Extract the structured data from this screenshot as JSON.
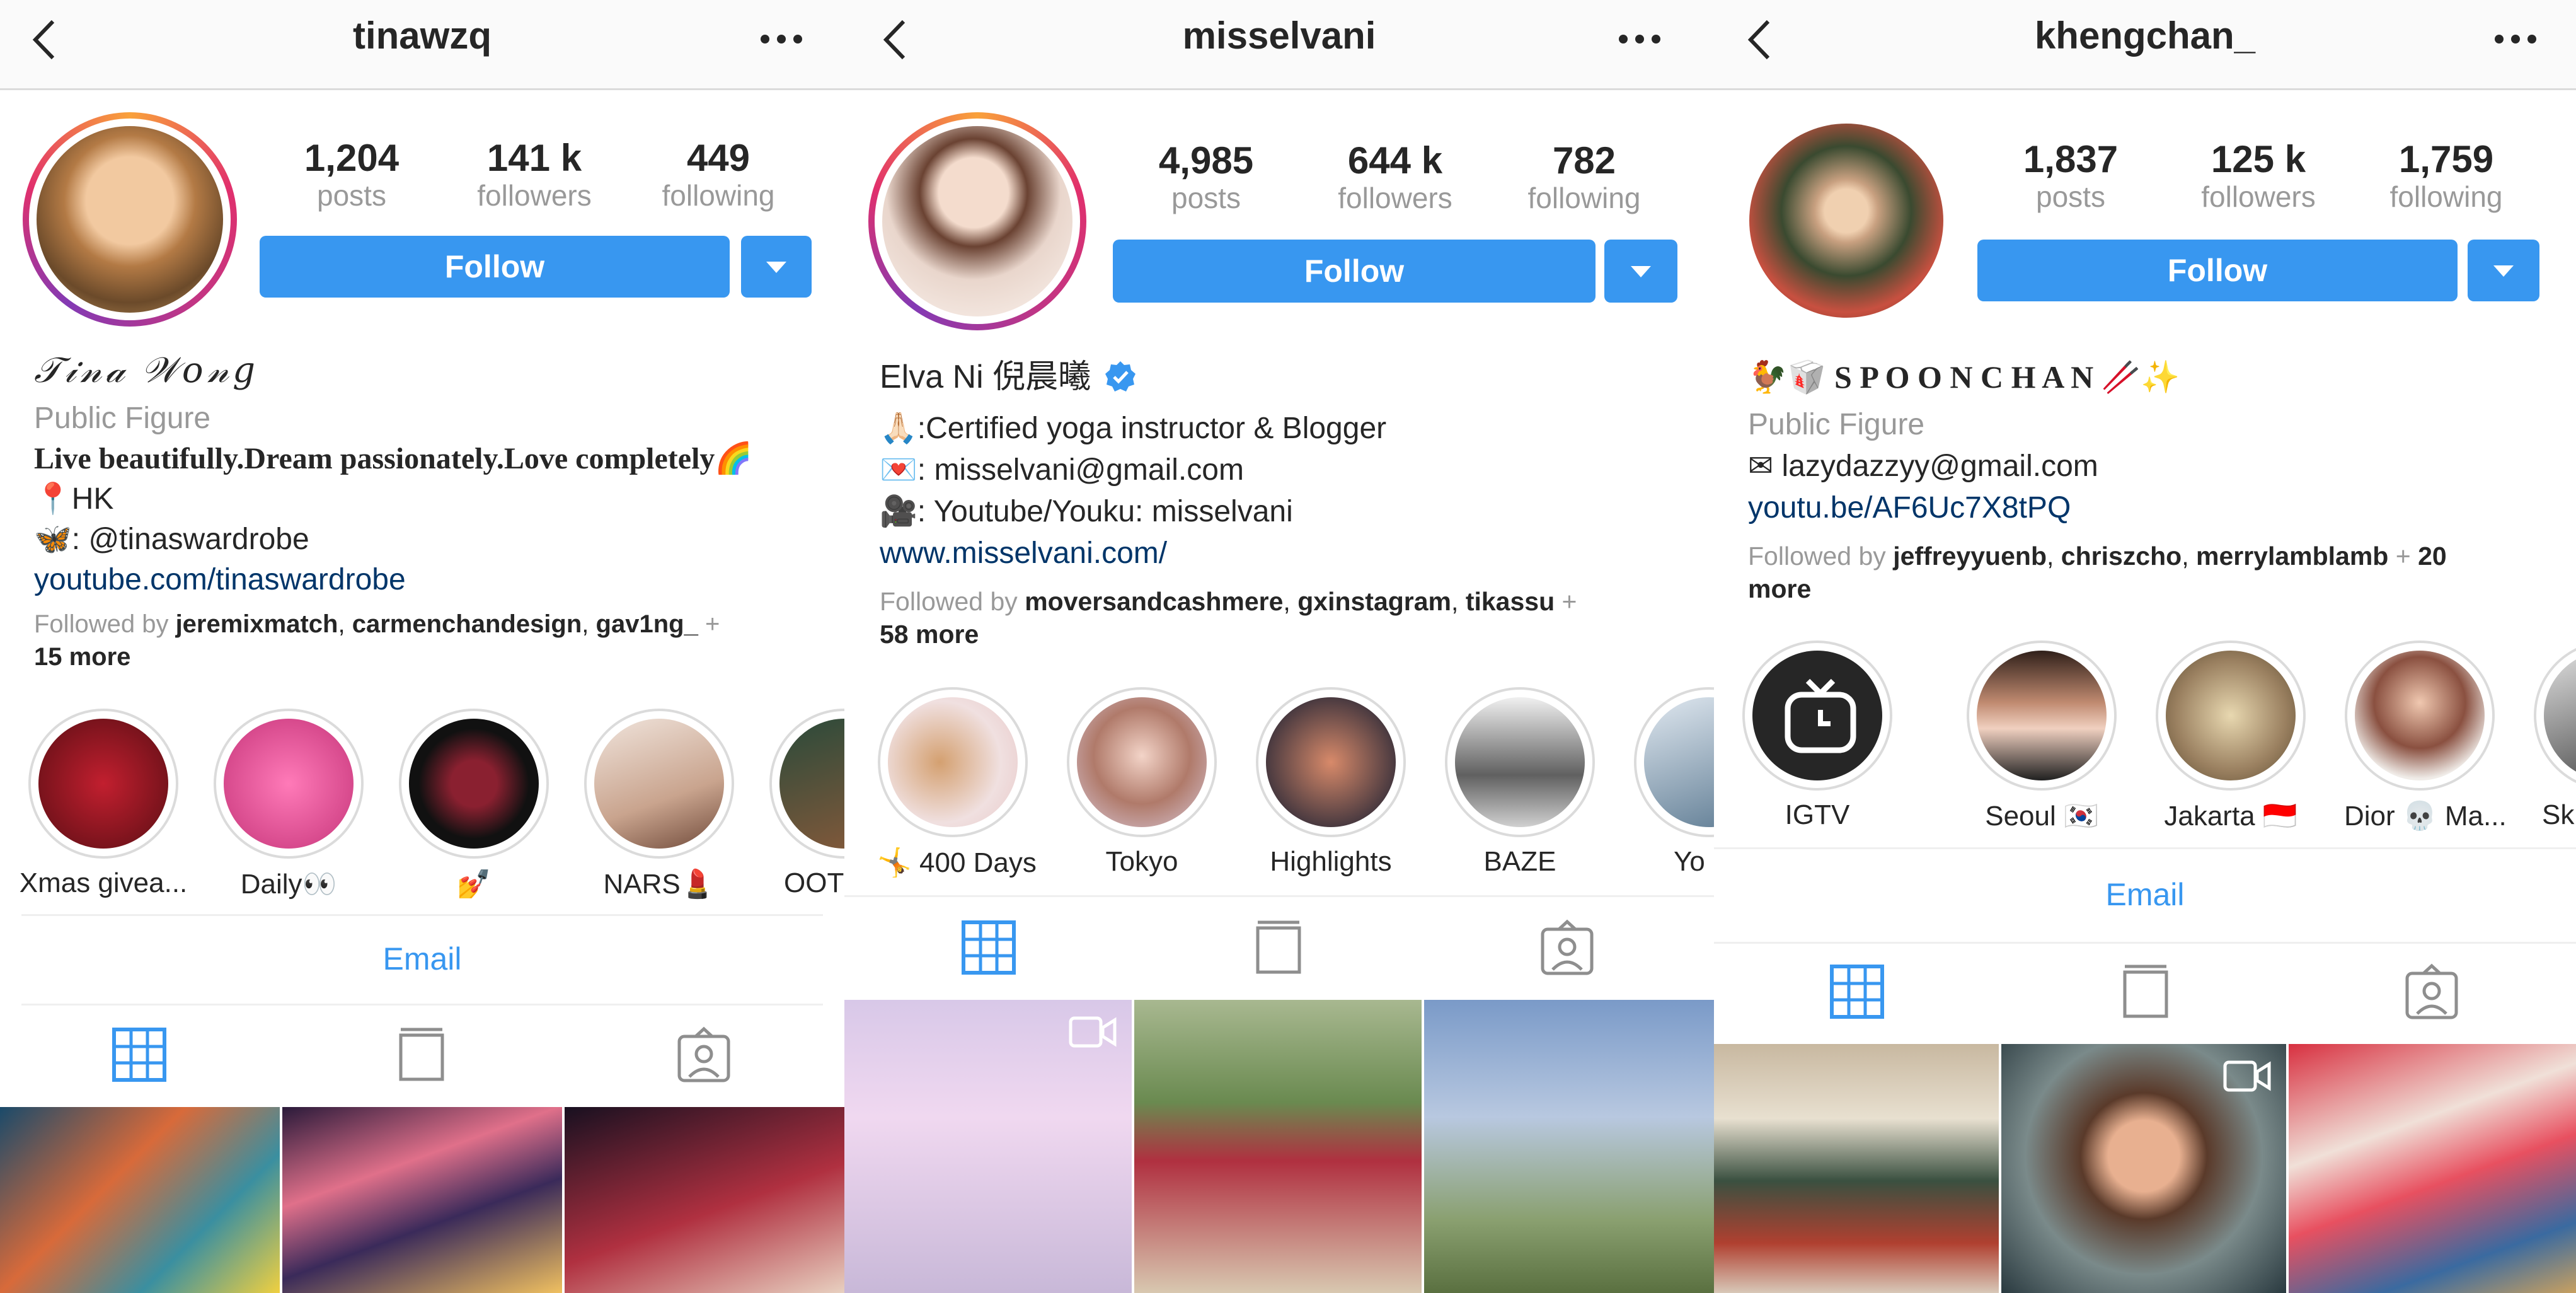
{
  "colors": {
    "accent": "#3897f0",
    "link": "#003569",
    "muted": "#999999",
    "divider": "#dbdbdb"
  },
  "profiles": [
    {
      "username": "tinawzq",
      "stats": [
        {
          "num": "1,204",
          "label": "posts"
        },
        {
          "num": "141 k",
          "label": "followers"
        },
        {
          "num": "449",
          "label": "following"
        }
      ],
      "follow_label": "Follow",
      "display_name": "𝒯𝒾𝓃𝒶 𝒲𝑜𝓃𝑔",
      "category": "Public Figure",
      "bio": [
        "Live beautifully.Dream passionately.Love completely🌈",
        "📍HK",
        "🦋: @tinaswardrobe"
      ],
      "website": "youtube.com/tinaswardrobe",
      "followed_by_prefix": "Followed by",
      "followed_by_names": [
        "jeremixmatch",
        "carmenchandesign",
        "gav1ng_"
      ],
      "followed_by_more": "15 more",
      "highlights": [
        "Xmas givea...",
        "Daily👀",
        "💅",
        "NARS💄",
        "OOT"
      ],
      "email_label": "Email",
      "tabs": [
        "grid-icon",
        "igtv-icon",
        "tagged-icon"
      ]
    },
    {
      "username": "misselvani",
      "stats": [
        {
          "num": "4,985",
          "label": "posts"
        },
        {
          "num": "644 k",
          "label": "followers"
        },
        {
          "num": "782",
          "label": "following"
        }
      ],
      "follow_label": "Follow",
      "display_name": "Elva Ni 倪晨曦",
      "verified": true,
      "bio": [
        "🙏🏻:Certified yoga instructor & Blogger",
        "💌: misselvani@gmail.com",
        "🎥: Youtube/Youku: misselvani"
      ],
      "website": "www.misselvani.com/",
      "followed_by_prefix": "Followed by",
      "followed_by_names": [
        "moversandcashmere",
        "gxinstagram",
        "tikassu"
      ],
      "followed_by_more": "58 more",
      "highlights": [
        "🤸 400 Days",
        "Tokyo",
        "Highlights",
        "BAZE",
        "Yo"
      ],
      "tabs": [
        "grid-icon",
        "igtv-icon",
        "tagged-icon"
      ]
    },
    {
      "username": "khengchan_",
      "stats": [
        {
          "num": "1,837",
          "label": "posts"
        },
        {
          "num": "125 k",
          "label": "followers"
        },
        {
          "num": "1,759",
          "label": "following"
        }
      ],
      "follow_label": "Follow",
      "display_name": "🐓🥡 S P O O N C H A N 🥢✨",
      "category": "Public Figure",
      "bio": [
        "✉ lazydazzyy@gmail.com"
      ],
      "website": "youtu.be/AF6Uc7X8tPQ",
      "followed_by_prefix": "Followed by",
      "followed_by_names": [
        "jeffreyyuenb",
        "chriszcho",
        "merrylamblamb"
      ],
      "followed_by_more": "20 more",
      "highlights": [
        "IGTV",
        "Seoul 🇰🇷",
        "Jakarta 🇮🇩",
        "Dior 💀 Ma...",
        "Ski"
      ],
      "email_label": "Email",
      "tabs": [
        "grid-icon",
        "igtv-icon",
        "tagged-icon"
      ]
    }
  ]
}
